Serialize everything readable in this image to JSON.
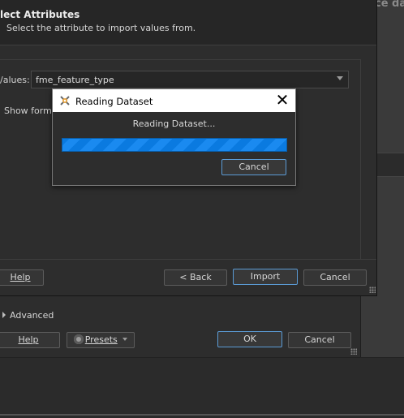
{
  "back_dialog": {
    "title_fragment": "ce da",
    "advanced_label": "Advanced",
    "help_label": "Help",
    "presets_label": "Presets",
    "ok_label": "OK",
    "cancel_label": "Cancel"
  },
  "select_dialog": {
    "title": "lect Attributes",
    "subtitle": "Select the attribute to import values from.",
    "values_label": "/alues:",
    "values_selected": "fme_feature_type",
    "show_formats_label": "Show forma",
    "help_label": "Help",
    "back_label": "< Back",
    "import_label": "Import",
    "cancel_label": "Cancel"
  },
  "reading_dialog": {
    "title": "Reading Dataset",
    "message": "Reading Dataset...",
    "progress_percent": 100,
    "cancel_label": "Cancel",
    "icon": "fme-workbench-icon",
    "close_icon": "close-icon"
  },
  "colors": {
    "accent": "#5b9bd5",
    "progress": "#0a7ae0",
    "background": "#2d2d2d"
  }
}
